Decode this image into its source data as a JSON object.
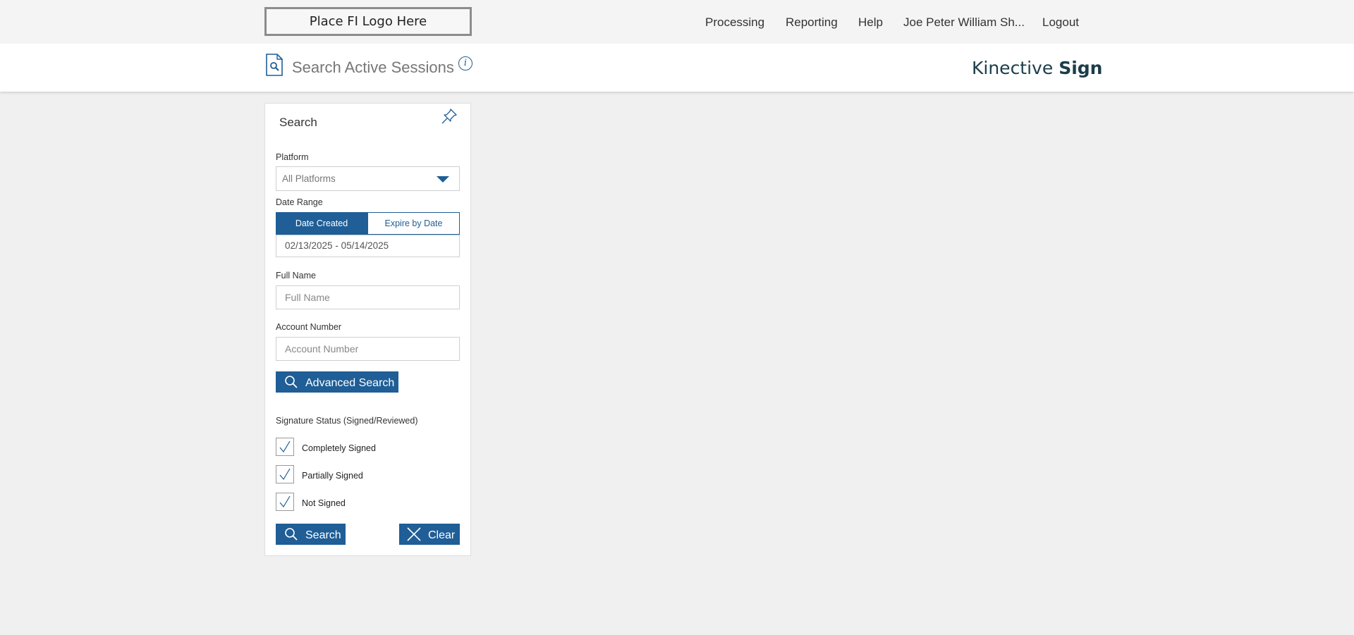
{
  "header": {
    "logo_text": "Place FI Logo Here",
    "nav": [
      "Processing",
      "Reporting",
      "Help",
      "Joe Peter William Sh...",
      "Logout"
    ]
  },
  "titlebar": {
    "title": "Search Active Sessions",
    "info_glyph": "i",
    "brand_light": "Kinective ",
    "brand_bold": "Sign"
  },
  "search_panel": {
    "title": "Search",
    "platform": {
      "label": "Platform",
      "value": "All Platforms"
    },
    "date_range": {
      "label": "Date Range",
      "tab_active": "Date Created",
      "tab_inactive": "Expire by Date",
      "value": "02/13/2025 - 05/14/2025"
    },
    "full_name": {
      "label": "Full Name",
      "placeholder": "Full Name"
    },
    "account_number": {
      "label": "Account Number",
      "placeholder": "Account Number"
    },
    "advanced_search_label": "Advanced Search",
    "signature_status": {
      "label": "Signature Status (Signed/Reviewed)",
      "options": [
        {
          "label": "Completely Signed",
          "checked": true
        },
        {
          "label": "Partially Signed",
          "checked": true
        },
        {
          "label": "Not Signed",
          "checked": true
        }
      ]
    },
    "search_label": "Search",
    "clear_label": "Clear"
  },
  "colors": {
    "accent": "#1f5e96",
    "brand": "#1b3d4a",
    "background": "#f0f0f0"
  }
}
